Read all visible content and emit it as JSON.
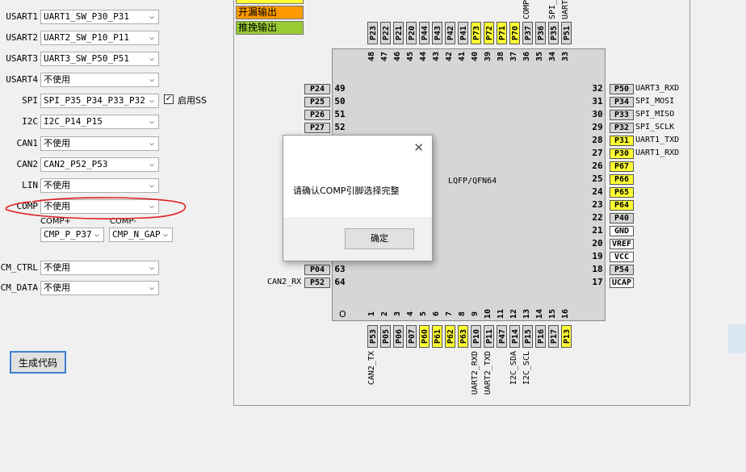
{
  "form": {
    "rows": [
      {
        "label": "USART1",
        "value": "UART1_SW_P30_P31"
      },
      {
        "label": "USART2",
        "value": "UART2_SW_P10_P11"
      },
      {
        "label": "USART3",
        "value": "UART3_SW_P50_P51"
      },
      {
        "label": "USART4",
        "value": "不使用"
      },
      {
        "label": "SPI",
        "value": "SPI_P35_P34_P33_P32"
      },
      {
        "label": "I2C",
        "value": "I2C_P14_P15"
      },
      {
        "label": "CAN1",
        "value": "不使用"
      },
      {
        "label": "CAN2",
        "value": "CAN2_P52_P53"
      },
      {
        "label": "LIN",
        "value": "不使用"
      },
      {
        "label": "COMP",
        "value": "不使用"
      },
      {
        "label": "CM_CTRL",
        "value": "不使用"
      },
      {
        "label": "CM_DATA",
        "value": "不使用"
      }
    ],
    "ss_checkbox": {
      "label": "启用SS",
      "checked": true
    },
    "comp_plus": {
      "label": "COMP+",
      "value": "CMP_P_P37"
    },
    "comp_minus": {
      "label": "COMP-",
      "value": "CMP_N_GAP"
    },
    "generate_button": "生成代码"
  },
  "legend": [
    {
      "label": "开漏输出",
      "color": "#ff9900"
    },
    {
      "label": "推挽输出",
      "color": "#99cc33"
    }
  ],
  "chip": {
    "package": "LQFP/QFN64",
    "corner_mark": "O",
    "top_pins": [
      {
        "num": "48",
        "name": "P23",
        "yellow": false
      },
      {
        "num": "47",
        "name": "P22",
        "yellow": false
      },
      {
        "num": "46",
        "name": "P21",
        "yellow": false
      },
      {
        "num": "45",
        "name": "P20",
        "yellow": false
      },
      {
        "num": "44",
        "name": "P44",
        "yellow": false
      },
      {
        "num": "43",
        "name": "P43",
        "yellow": false
      },
      {
        "num": "42",
        "name": "P42",
        "yellow": false
      },
      {
        "num": "41",
        "name": "P41",
        "yellow": false
      },
      {
        "num": "40",
        "name": "P73",
        "yellow": true
      },
      {
        "num": "39",
        "name": "P72",
        "yellow": true
      },
      {
        "num": "38",
        "name": "P71",
        "yellow": true
      },
      {
        "num": "37",
        "name": "P70",
        "yellow": true
      },
      {
        "num": "36",
        "name": "P37",
        "yellow": false,
        "func": "COMP"
      },
      {
        "num": "35",
        "name": "P36",
        "yellow": false
      },
      {
        "num": "34",
        "name": "P35",
        "yellow": false,
        "func": "SPI_"
      },
      {
        "num": "33",
        "name": "P51",
        "yellow": false,
        "func": "UART"
      }
    ],
    "left_pins": [
      {
        "num": "49",
        "name": "P24"
      },
      {
        "num": "50",
        "name": "P25"
      },
      {
        "num": "51",
        "name": "P26"
      },
      {
        "num": "52",
        "name": "P27"
      },
      {
        "num": "63",
        "name": "P04"
      },
      {
        "num": "64",
        "name": "P52",
        "func": "CAN2_RX"
      }
    ],
    "right_pins": [
      {
        "num": "32",
        "name": "P50",
        "yellow": false,
        "func": "UART3_RXD"
      },
      {
        "num": "31",
        "name": "P34",
        "yellow": false,
        "func": "SPI_MOSI"
      },
      {
        "num": "30",
        "name": "P33",
        "yellow": false,
        "func": "SPI_MISO"
      },
      {
        "num": "29",
        "name": "P32",
        "yellow": false,
        "func": "SPI_SCLK"
      },
      {
        "num": "28",
        "name": "P31",
        "yellow": true,
        "func": "UART1_TXD"
      },
      {
        "num": "27",
        "name": "P30",
        "yellow": true,
        "func": "UART1_RXD"
      },
      {
        "num": "26",
        "name": "P67",
        "yellow": true
      },
      {
        "num": "25",
        "name": "P66",
        "yellow": true
      },
      {
        "num": "24",
        "name": "P65",
        "yellow": true
      },
      {
        "num": "23",
        "name": "P64",
        "yellow": true
      },
      {
        "num": "22",
        "name": "P40",
        "yellow": false
      },
      {
        "num": "21",
        "name": "GND",
        "yellow": false,
        "white": true
      },
      {
        "num": "20",
        "name": "VREF",
        "yellow": false,
        "white": true
      },
      {
        "num": "19",
        "name": "VCC",
        "yellow": false,
        "white": true
      },
      {
        "num": "18",
        "name": "P54",
        "yellow": false
      },
      {
        "num": "17",
        "name": "UCAP",
        "yellow": false,
        "white": true
      }
    ],
    "bottom_pins": [
      {
        "num": "1",
        "name": "P53",
        "yellow": false,
        "func": "CAN2_TX"
      },
      {
        "num": "2",
        "name": "P05",
        "yellow": false
      },
      {
        "num": "3",
        "name": "P06",
        "yellow": false
      },
      {
        "num": "4",
        "name": "P07",
        "yellow": false
      },
      {
        "num": "5",
        "name": "P60",
        "yellow": true
      },
      {
        "num": "6",
        "name": "P61",
        "yellow": true
      },
      {
        "num": "7",
        "name": "P62",
        "yellow": true
      },
      {
        "num": "8",
        "name": "P63",
        "yellow": true
      },
      {
        "num": "9",
        "name": "P10",
        "yellow": false,
        "func": "UART2_RXD"
      },
      {
        "num": "10",
        "name": "P11",
        "yellow": false,
        "func": "UART2_TXD"
      },
      {
        "num": "11",
        "name": "P47",
        "yellow": false
      },
      {
        "num": "12",
        "name": "P14",
        "yellow": false,
        "func": "I2C_SDA"
      },
      {
        "num": "13",
        "name": "P15",
        "yellow": false,
        "func": "I2C_SCL"
      },
      {
        "num": "14",
        "name": "P16",
        "yellow": false
      },
      {
        "num": "15",
        "name": "P17",
        "yellow": false
      },
      {
        "num": "16",
        "name": "P13",
        "yellow": true
      }
    ]
  },
  "dialog": {
    "message": "请确认COMP引脚选择完整",
    "ok": "确定",
    "close_icon": "close-icon"
  },
  "annotation": {
    "color": "#e02020"
  }
}
